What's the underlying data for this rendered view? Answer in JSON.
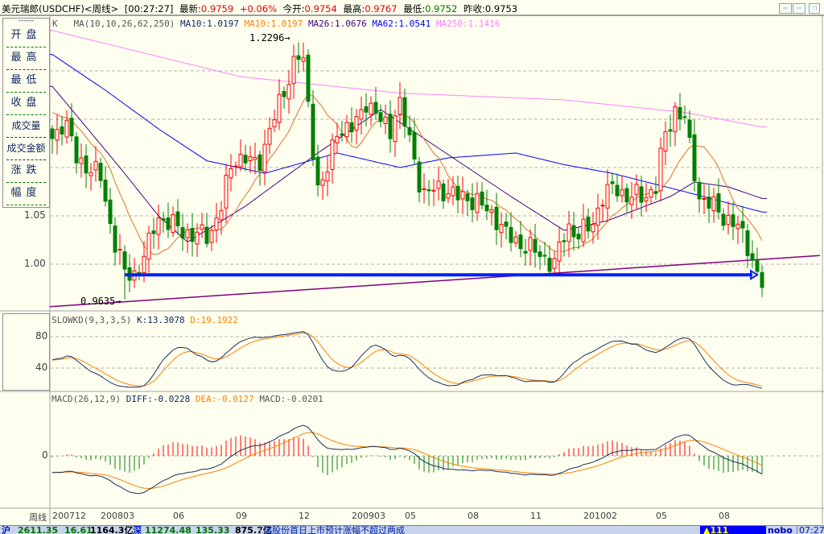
{
  "title_bar": {
    "symbol": "美元瑞郎(USDCHF)<周线>",
    "time": "[00:27:27]",
    "latest_label": "最新:",
    "latest": "0.9759",
    "change": "+0.06%",
    "open_label": "今开:",
    "open": "0.9754",
    "high_label": "最高:",
    "high": "0.9767",
    "low_label": "最低:",
    "low": "0.9752",
    "prev_close_label": "昨收:",
    "prev_close": "0.9753",
    "nav_buttons": [
      "prev-arrow-icon",
      "next-arrow-icon",
      "restore-window-icon"
    ]
  },
  "info_panel": {
    "header": "------",
    "items": [
      "开盘",
      "最高",
      "最低",
      "收盘",
      "成交量",
      "成交金额",
      "涨跌",
      "幅度"
    ]
  },
  "main_legend": {
    "k": "K",
    "ma": "MA(10,10,26,62,250)",
    "ma10a": "MA10:1.0197",
    "ma10b": "MA10:1.0197",
    "ma26": "MA26:1.0676",
    "ma62": "MA62:1.0541",
    "ma250": "MA250:1.1416"
  },
  "kd_legend": {
    "name": "SLOWKD(9,3,3,5)",
    "k": "K:13.3078",
    "d": "D:19.1922"
  },
  "macd_legend": {
    "name": "MACD(26,12,9)",
    "diff": "DIFF:-0.0228",
    "dea": "DEA:-0.0127",
    "macd": "MACD:-0.0201"
  },
  "annotations": {
    "high": "1.2296",
    "low": "0.9635"
  },
  "y_labels": {
    "p105": "1.05",
    "p100": "1.00",
    "kd80": "80",
    "kd40": "40",
    "macd0": "0"
  },
  "x_axis": {
    "period": "周线",
    "labels": [
      [
        "200712",
        0
      ],
      [
        "200803",
        13
      ],
      [
        "06",
        26
      ],
      [
        "09",
        39
      ],
      [
        "12",
        52
      ],
      [
        "200903",
        65
      ],
      [
        "05",
        74
      ],
      [
        "08",
        87
      ],
      [
        "11",
        100
      ],
      [
        "201002",
        113
      ],
      [
        "05",
        126
      ],
      [
        "08",
        139
      ]
    ]
  },
  "status_bar": {
    "sh_label": "沪",
    "sh_index": "2611.35",
    "sh_change": "16.61",
    "sh_amount": "1164.3亿",
    "sz_label": "深",
    "sz_index": "11274.48",
    "sz_change": "135.33",
    "sz_amount": "875.7亿",
    "ticker": "瑞股份首日上市预计涨幅不超过两成",
    "alert": "▲111",
    "user": "nobo",
    "clock": "07:27"
  },
  "colors": {
    "up": "#ff0000",
    "down": "#008000",
    "ma10": "#e07030",
    "ma26": "#400080",
    "ma62": "#0000ff",
    "ma250": "#ff80ff",
    "support": "#0020ff",
    "trend": "#800080",
    "kd_k": "#1a3060",
    "kd_d": "#ff8000"
  },
  "chart_data": {
    "type": "candlestick",
    "weeks": 148,
    "close_keypoints": [
      [
        0,
        1.13
      ],
      [
        2.5,
        1.15
      ],
      [
        5,
        1.11
      ],
      [
        7.5,
        1.1
      ],
      [
        10,
        1.09
      ],
      [
        12.5,
        1.03
      ],
      [
        15,
        0.99
      ],
      [
        17.5,
        0.99
      ],
      [
        20,
        1.02
      ],
      [
        21.7,
        1.05
      ],
      [
        25,
        1.04
      ],
      [
        29,
        1.03
      ],
      [
        32.5,
        1.03
      ],
      [
        35,
        1.06
      ],
      [
        37.5,
        1.11
      ],
      [
        40,
        1.11
      ],
      [
        42.5,
        1.1
      ],
      [
        45,
        1.14
      ],
      [
        47.5,
        1.17
      ],
      [
        50,
        1.21
      ],
      [
        51.7,
        1.22
      ],
      [
        53.3,
        1.15
      ],
      [
        55,
        1.08
      ],
      [
        56.7,
        1.09
      ],
      [
        59,
        1.14
      ],
      [
        62.5,
        1.14
      ],
      [
        65,
        1.17
      ],
      [
        67.5,
        1.15
      ],
      [
        70,
        1.14
      ],
      [
        71.7,
        1.17
      ],
      [
        73.3,
        1.14
      ],
      [
        75,
        1.11
      ],
      [
        76.7,
        1.07
      ],
      [
        80,
        1.08
      ],
      [
        83.3,
        1.07
      ],
      [
        85.8,
        1.07
      ],
      [
        89,
        1.06
      ],
      [
        91.7,
        1.05
      ],
      [
        94,
        1.03
      ],
      [
        97.5,
        1.02
      ],
      [
        101,
        1.01
      ],
      [
        104,
        1.0
      ],
      [
        106.7,
        1.04
      ],
      [
        109,
        1.03
      ],
      [
        111.7,
        1.04
      ],
      [
        114,
        1.07
      ],
      [
        116.7,
        1.08
      ],
      [
        119,
        1.07
      ],
      [
        122.5,
        1.07
      ],
      [
        125,
        1.08
      ],
      [
        126.7,
        1.13
      ],
      [
        129,
        1.16
      ],
      [
        131,
        1.15
      ],
      [
        132,
        1.12
      ],
      [
        134,
        1.07
      ],
      [
        136.7,
        1.06
      ],
      [
        139,
        1.05
      ],
      [
        141.7,
        1.04
      ],
      [
        144,
        1.02
      ],
      [
        146,
        0.99
      ],
      [
        147,
        0.9759
      ]
    ],
    "extremes": {
      "high": {
        "week": 51,
        "value": 1.2296
      },
      "low": {
        "week": 15,
        "value": 0.9635
      }
    },
    "ma26_keypoints": [
      [
        0,
        1.184
      ],
      [
        14,
        1.1
      ],
      [
        22,
        1.05
      ],
      [
        28,
        1.023
      ],
      [
        40,
        1.06
      ],
      [
        55,
        1.115
      ],
      [
        68,
        1.16
      ],
      [
        80,
        1.12
      ],
      [
        95,
        1.07
      ],
      [
        106,
        1.035
      ],
      [
        115,
        1.045
      ],
      [
        128,
        1.07
      ],
      [
        133,
        1.085
      ],
      [
        140,
        1.08
      ],
      [
        147,
        1.068
      ]
    ],
    "ma62_keypoints": [
      [
        0,
        1.217
      ],
      [
        11,
        1.18
      ],
      [
        22,
        1.14
      ],
      [
        32,
        1.107
      ],
      [
        44,
        1.094
      ],
      [
        59,
        1.115
      ],
      [
        72,
        1.1
      ],
      [
        82,
        1.11
      ],
      [
        96,
        1.115
      ],
      [
        106,
        1.103
      ],
      [
        116,
        1.094
      ],
      [
        131,
        1.075
      ],
      [
        147,
        1.054
      ]
    ],
    "ma250_keypoints": [
      [
        -1,
        1.243
      ],
      [
        39,
        1.194
      ],
      [
        72,
        1.177
      ],
      [
        106,
        1.17
      ],
      [
        131,
        1.157
      ],
      [
        147,
        1.142
      ]
    ],
    "support_line": {
      "value": 0.989,
      "from_week": 15,
      "to_week": 146
    },
    "trend_line": {
      "from": [
        -0.5,
        0.956
      ],
      "to": [
        159,
        1.009
      ]
    },
    "y_ticks": [
      1.0,
      1.05,
      1.1,
      1.15,
      1.2
    ],
    "kd_ticks": [
      40,
      80
    ]
  }
}
